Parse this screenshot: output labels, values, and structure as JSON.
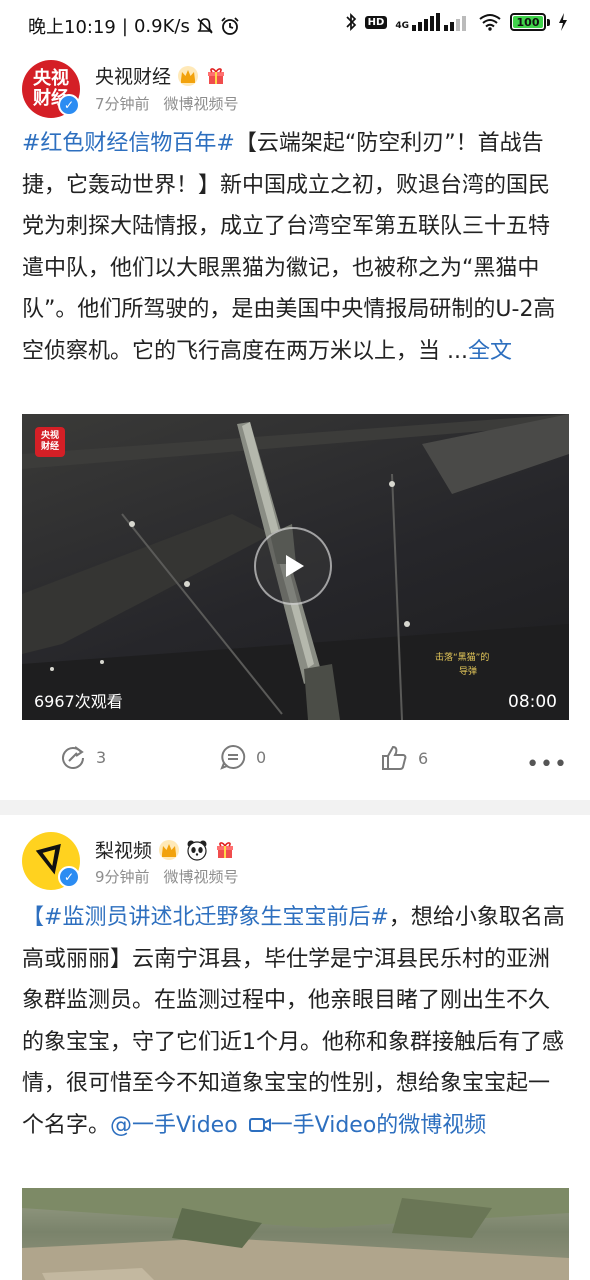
{
  "status_bar": {
    "time": "晚上10:19",
    "separator": "|",
    "speed": "0.9K/s",
    "hd": "HD",
    "network": "4G",
    "battery": "100"
  },
  "posts": [
    {
      "author": "央视财经",
      "avatar_text": [
        "央视",
        "财经"
      ],
      "time": "7分钟前",
      "source": "微博视频号",
      "topic": "#红色财经信物百年#",
      "text": "【云端架起“防空利刃”！首战告捷，它轰动世界！】新中国成立之初，败退台湾的国民党为刺探大陆情报，成立了台湾空军第五联队三十五特遣中队，他们以大眼黑猫为徽记，也被称之为“黑猫中队”。他们所驾驶的，是由美国中央情报局研制的U-2高空侦察机。它的飞行高度在两万米以上，当 ...",
      "more_link": "全文",
      "video": {
        "logo_text": [
          "央视",
          "财经"
        ],
        "views": "6967次观看",
        "duration": "08:00",
        "caption": [
          "击落“黑猫”的",
          "导弹"
        ]
      },
      "actions": {
        "repost": "3",
        "comment": "0",
        "like": "6"
      }
    },
    {
      "author": "梨视频",
      "time": "9分钟前",
      "source": "微博视频号",
      "text_prefix": "【",
      "topic": "#监测员讲述北迁野象生宝宝前后#",
      "text": "，想给小象取名高高或丽丽】云南宁洱县，毕仕学是宁洱县民乐村的亚洲象群监测员。在监测过程中，他亲眼目睹了刚出生不久的象宝宝，守了它们近1个月。他称和象群接触后有了感情，很可惜至今不知道象宝宝的性别，想给象宝宝起一个名字。",
      "mention": "@一手Video",
      "video_link": "一手Video的微博视频"
    }
  ]
}
